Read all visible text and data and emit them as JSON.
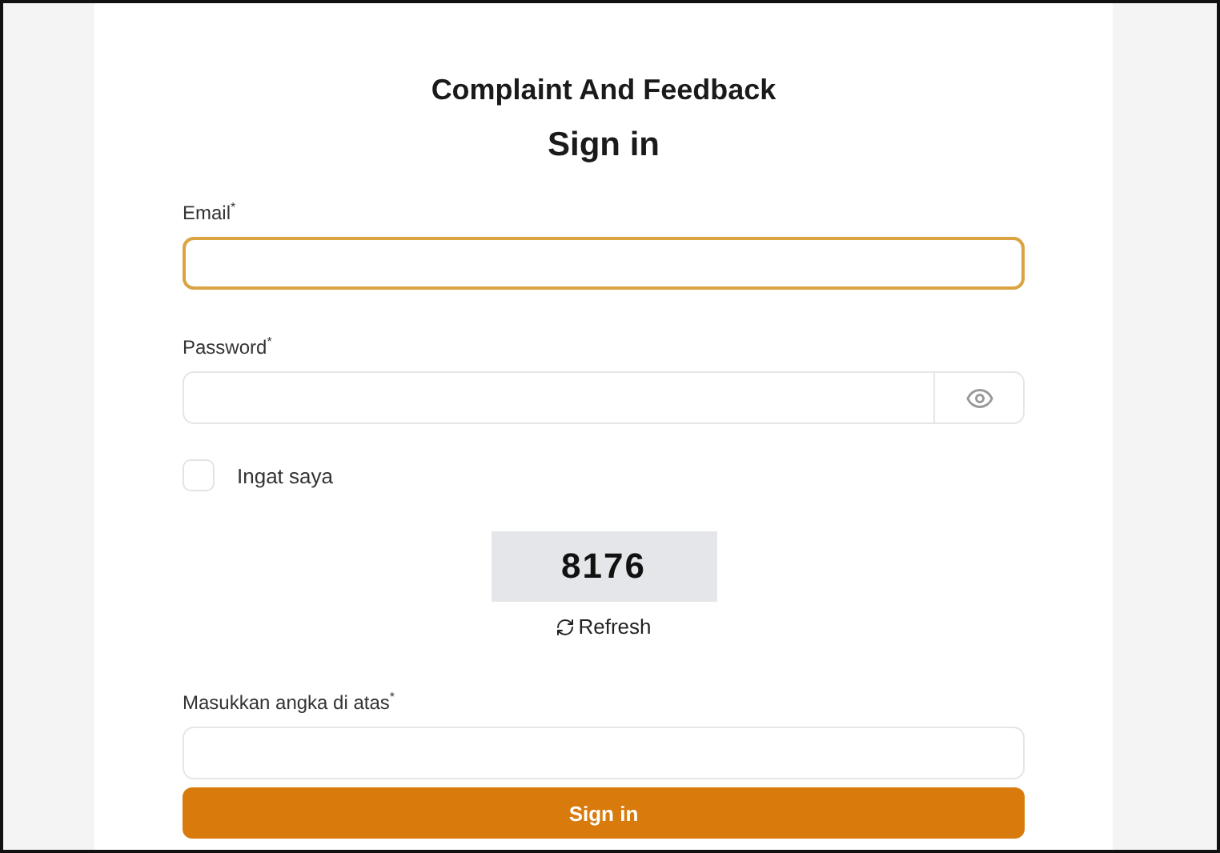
{
  "app_title": "Complaint And Feedback",
  "heading": "Sign in",
  "fields": [
    {
      "kind": "text",
      "label": "Email$^{*}$",
      "focused": true
    },
    {
      "kind": "password",
      "label": "Password$^{*}$",
      "focused": false
    }
  ],
  "remember": {
    "label": "Ingat saya",
    "checked": false
  },
  "captcha": {
    "code": "8176",
    "refresh_label": "Refresh"
  },
  "captcha_field": {
    "kind": "text",
    "label": "Masukkan angka di atas$^{*}$",
    "focused": false
  },
  "submit": "Sign in"
}
